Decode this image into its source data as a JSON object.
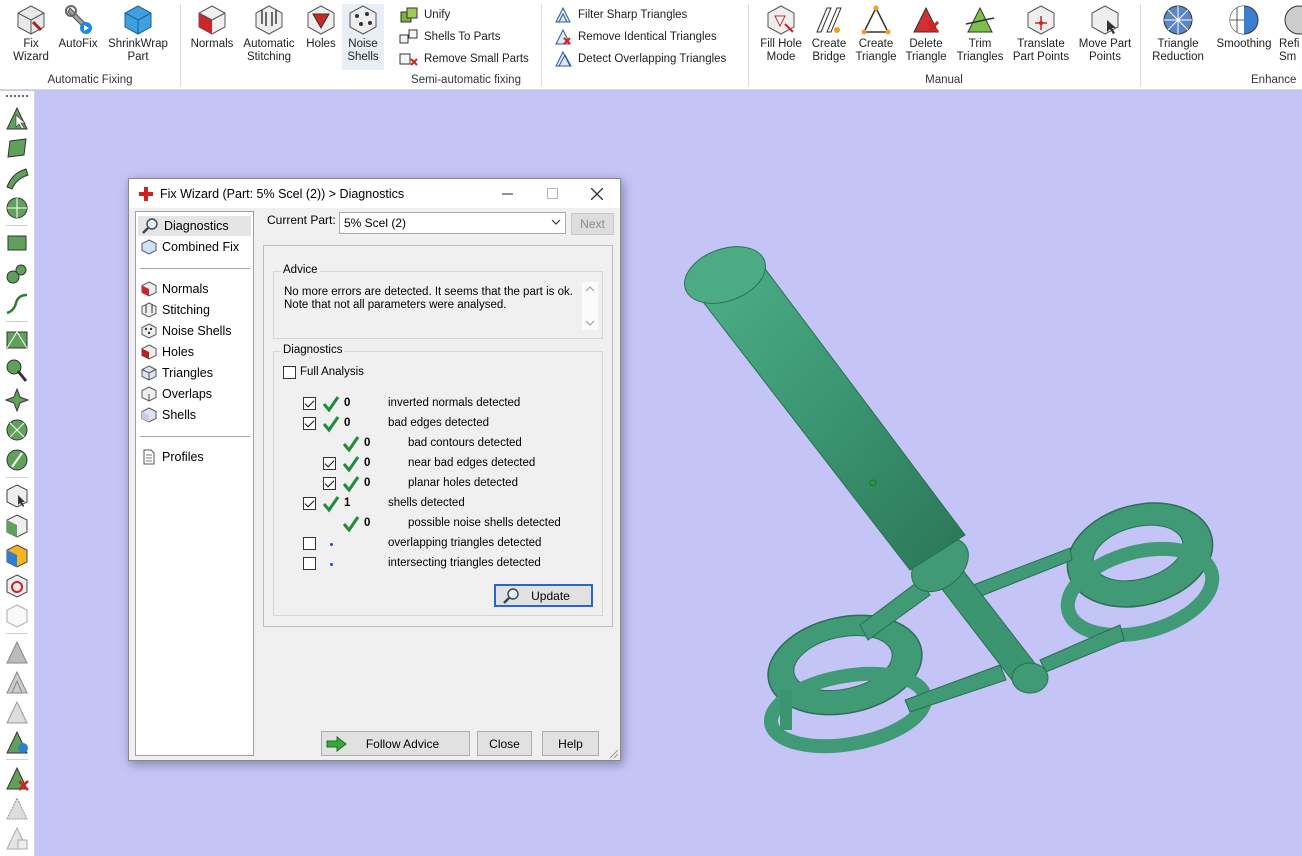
{
  "ribbon": {
    "groups": [
      {
        "label": "Automatic Fixing"
      },
      {
        "label": "Semi-automatic fixing"
      },
      {
        "label": "Manual"
      },
      {
        "label": "Enhance"
      }
    ],
    "buttons": {
      "fix_wizard": "Fix\nWizard",
      "autofix": "AutoFix",
      "shrinkwrap": "ShrinkWrap\nPart",
      "normals": "Normals",
      "auto_stitching": "Automatic\nStitching",
      "holes": "Holes",
      "noise_shells": "Noise\nShells",
      "unify": "Unify",
      "shells_to_parts": "Shells To Parts",
      "remove_small_parts": "Remove Small Parts",
      "filter_sharp": "Filter Sharp Triangles",
      "remove_identical": "Remove Identical Triangles",
      "detect_overlapping": "Detect Overlapping Triangles",
      "fill_hole_mode": "Fill Hole\nMode",
      "create_bridge": "Create\nBridge",
      "create_triangle": "Create\nTriangle",
      "delete_triangle": "Delete\nTriangle",
      "trim_triangles": "Trim\nTriangles",
      "translate_part_points": "Translate\nPart Points",
      "move_part_points": "Move Part\nPoints",
      "triangle_reduction": "Triangle\nReduction",
      "smoothing": "Smoothing",
      "refine": "Refi\nSm"
    }
  },
  "dialog": {
    "title": "Fix Wizard (Part: 5% Scel (2)) > Diagnostics",
    "nav_top": [
      "Diagnostics",
      "Combined Fix"
    ],
    "nav_mid": [
      "Normals",
      "Stitching",
      "Noise Shells",
      "Holes",
      "Triangles",
      "Overlaps",
      "Shells"
    ],
    "nav_bottom": [
      "Profiles"
    ],
    "current_part_label": "Current Part:",
    "current_part_value": "5% Scel (2)",
    "next_label": "Next",
    "advice_legend": "Advice",
    "advice_line1": "No more errors are detected. It seems that the part is ok.",
    "advice_line2": "Note that not all parameters were analysed.",
    "diagnostics_legend": "Diagnostics",
    "full_analysis_label": "Full Analysis",
    "full_analysis_checked": false,
    "rows": [
      {
        "checkbox": true,
        "checked": true,
        "status": "ok",
        "count": "0",
        "text": "inverted normals detected",
        "indent": 0
      },
      {
        "checkbox": true,
        "checked": true,
        "status": "ok",
        "count": "0",
        "text": "bad edges detected",
        "indent": 0
      },
      {
        "checkbox": false,
        "checked": false,
        "status": "ok",
        "count": "0",
        "text": "bad contours detected",
        "indent": 1
      },
      {
        "checkbox": true,
        "checked": true,
        "status": "ok",
        "count": "0",
        "text": "near bad edges detected",
        "indent": 1
      },
      {
        "checkbox": true,
        "checked": true,
        "status": "ok",
        "count": "0",
        "text": "planar holes detected",
        "indent": 1
      },
      {
        "checkbox": true,
        "checked": true,
        "status": "ok",
        "count": "1",
        "text": "shells detected",
        "indent": 0
      },
      {
        "checkbox": false,
        "checked": false,
        "status": "ok",
        "count": "0",
        "text": "possible noise shells detected",
        "indent": 1
      },
      {
        "checkbox": true,
        "checked": false,
        "status": "dot",
        "count": "",
        "text": "overlapping triangles detected",
        "indent": 0
      },
      {
        "checkbox": true,
        "checked": false,
        "status": "dot",
        "count": "",
        "text": "intersecting triangles detected",
        "indent": 0
      }
    ],
    "update_label": "Update",
    "follow_advice_label": "Follow Advice",
    "close_label": "Close",
    "help_label": "Help"
  },
  "colors": {
    "viewport_bg": "#c4c4f7",
    "model": "#3f9a75",
    "check_green": "#1f8a3a",
    "title_icon_red": "#d22020"
  }
}
